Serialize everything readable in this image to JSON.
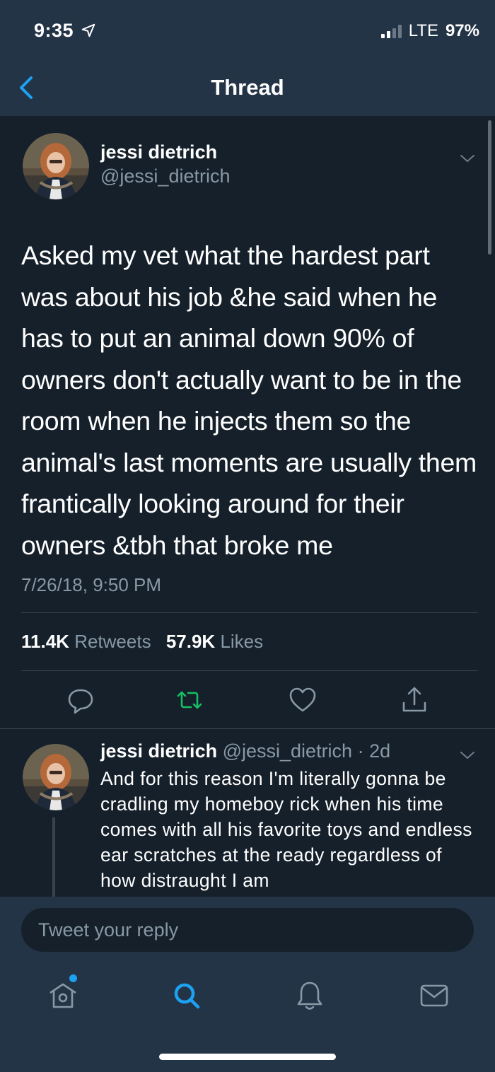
{
  "status_bar": {
    "time": "9:35",
    "network": "LTE",
    "battery": "97%"
  },
  "nav": {
    "title": "Thread"
  },
  "main_tweet": {
    "display_name": "jessi dietrich",
    "handle": "@jessi_dietrich",
    "text": "Asked my vet what the hardest part was about his job &he said when he has to put an animal down 90% of owners don't actually want to be in the room when he injects them so the animal's last moments are usually them frantically looking around for their owners &tbh that broke me",
    "timestamp": "7/26/18, 9:50 PM",
    "retweets_count": "11.4K",
    "retweets_label": "Retweets",
    "likes_count": "57.9K",
    "likes_label": "Likes"
  },
  "reply_tweet": {
    "display_name": "jessi dietrich",
    "handle": "@jessi_dietrich",
    "age": "2d",
    "text": "And for this reason I'm literally gonna be cradling my homeboy rick when his time comes with all his favorite toys and endless ear scratches at the ready regardless of how distraught I am"
  },
  "composer": {
    "placeholder": "Tweet your reply"
  },
  "icons": {
    "actions": [
      "reply-icon",
      "retweet-icon",
      "like-icon",
      "share-icon"
    ],
    "tabs": [
      "home-icon",
      "search-icon",
      "notifications-icon",
      "messages-icon"
    ]
  },
  "colors": {
    "background": "#15202b",
    "bar": "#243447",
    "secondary_text": "#8899a6",
    "accent": "#1da1f2",
    "retweet_active": "#17bf63",
    "divider": "#38444d"
  }
}
